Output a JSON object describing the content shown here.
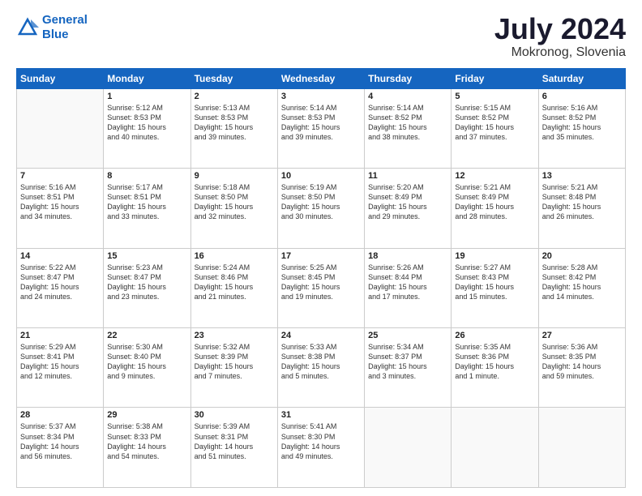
{
  "logo": {
    "line1": "General",
    "line2": "Blue"
  },
  "title": "July 2024",
  "location": "Mokronog, Slovenia",
  "weekdays": [
    "Sunday",
    "Monday",
    "Tuesday",
    "Wednesday",
    "Thursday",
    "Friday",
    "Saturday"
  ],
  "weeks": [
    [
      {
        "day": "",
        "info": ""
      },
      {
        "day": "1",
        "info": "Sunrise: 5:12 AM\nSunset: 8:53 PM\nDaylight: 15 hours\nand 40 minutes."
      },
      {
        "day": "2",
        "info": "Sunrise: 5:13 AM\nSunset: 8:53 PM\nDaylight: 15 hours\nand 39 minutes."
      },
      {
        "day": "3",
        "info": "Sunrise: 5:14 AM\nSunset: 8:53 PM\nDaylight: 15 hours\nand 39 minutes."
      },
      {
        "day": "4",
        "info": "Sunrise: 5:14 AM\nSunset: 8:52 PM\nDaylight: 15 hours\nand 38 minutes."
      },
      {
        "day": "5",
        "info": "Sunrise: 5:15 AM\nSunset: 8:52 PM\nDaylight: 15 hours\nand 37 minutes."
      },
      {
        "day": "6",
        "info": "Sunrise: 5:16 AM\nSunset: 8:52 PM\nDaylight: 15 hours\nand 35 minutes."
      }
    ],
    [
      {
        "day": "7",
        "info": "Sunrise: 5:16 AM\nSunset: 8:51 PM\nDaylight: 15 hours\nand 34 minutes."
      },
      {
        "day": "8",
        "info": "Sunrise: 5:17 AM\nSunset: 8:51 PM\nDaylight: 15 hours\nand 33 minutes."
      },
      {
        "day": "9",
        "info": "Sunrise: 5:18 AM\nSunset: 8:50 PM\nDaylight: 15 hours\nand 32 minutes."
      },
      {
        "day": "10",
        "info": "Sunrise: 5:19 AM\nSunset: 8:50 PM\nDaylight: 15 hours\nand 30 minutes."
      },
      {
        "day": "11",
        "info": "Sunrise: 5:20 AM\nSunset: 8:49 PM\nDaylight: 15 hours\nand 29 minutes."
      },
      {
        "day": "12",
        "info": "Sunrise: 5:21 AM\nSunset: 8:49 PM\nDaylight: 15 hours\nand 28 minutes."
      },
      {
        "day": "13",
        "info": "Sunrise: 5:21 AM\nSunset: 8:48 PM\nDaylight: 15 hours\nand 26 minutes."
      }
    ],
    [
      {
        "day": "14",
        "info": "Sunrise: 5:22 AM\nSunset: 8:47 PM\nDaylight: 15 hours\nand 24 minutes."
      },
      {
        "day": "15",
        "info": "Sunrise: 5:23 AM\nSunset: 8:47 PM\nDaylight: 15 hours\nand 23 minutes."
      },
      {
        "day": "16",
        "info": "Sunrise: 5:24 AM\nSunset: 8:46 PM\nDaylight: 15 hours\nand 21 minutes."
      },
      {
        "day": "17",
        "info": "Sunrise: 5:25 AM\nSunset: 8:45 PM\nDaylight: 15 hours\nand 19 minutes."
      },
      {
        "day": "18",
        "info": "Sunrise: 5:26 AM\nSunset: 8:44 PM\nDaylight: 15 hours\nand 17 minutes."
      },
      {
        "day": "19",
        "info": "Sunrise: 5:27 AM\nSunset: 8:43 PM\nDaylight: 15 hours\nand 15 minutes."
      },
      {
        "day": "20",
        "info": "Sunrise: 5:28 AM\nSunset: 8:42 PM\nDaylight: 15 hours\nand 14 minutes."
      }
    ],
    [
      {
        "day": "21",
        "info": "Sunrise: 5:29 AM\nSunset: 8:41 PM\nDaylight: 15 hours\nand 12 minutes."
      },
      {
        "day": "22",
        "info": "Sunrise: 5:30 AM\nSunset: 8:40 PM\nDaylight: 15 hours\nand 9 minutes."
      },
      {
        "day": "23",
        "info": "Sunrise: 5:32 AM\nSunset: 8:39 PM\nDaylight: 15 hours\nand 7 minutes."
      },
      {
        "day": "24",
        "info": "Sunrise: 5:33 AM\nSunset: 8:38 PM\nDaylight: 15 hours\nand 5 minutes."
      },
      {
        "day": "25",
        "info": "Sunrise: 5:34 AM\nSunset: 8:37 PM\nDaylight: 15 hours\nand 3 minutes."
      },
      {
        "day": "26",
        "info": "Sunrise: 5:35 AM\nSunset: 8:36 PM\nDaylight: 15 hours\nand 1 minute."
      },
      {
        "day": "27",
        "info": "Sunrise: 5:36 AM\nSunset: 8:35 PM\nDaylight: 14 hours\nand 59 minutes."
      }
    ],
    [
      {
        "day": "28",
        "info": "Sunrise: 5:37 AM\nSunset: 8:34 PM\nDaylight: 14 hours\nand 56 minutes."
      },
      {
        "day": "29",
        "info": "Sunrise: 5:38 AM\nSunset: 8:33 PM\nDaylight: 14 hours\nand 54 minutes."
      },
      {
        "day": "30",
        "info": "Sunrise: 5:39 AM\nSunset: 8:31 PM\nDaylight: 14 hours\nand 51 minutes."
      },
      {
        "day": "31",
        "info": "Sunrise: 5:41 AM\nSunset: 8:30 PM\nDaylight: 14 hours\nand 49 minutes."
      },
      {
        "day": "",
        "info": ""
      },
      {
        "day": "",
        "info": ""
      },
      {
        "day": "",
        "info": ""
      }
    ]
  ]
}
